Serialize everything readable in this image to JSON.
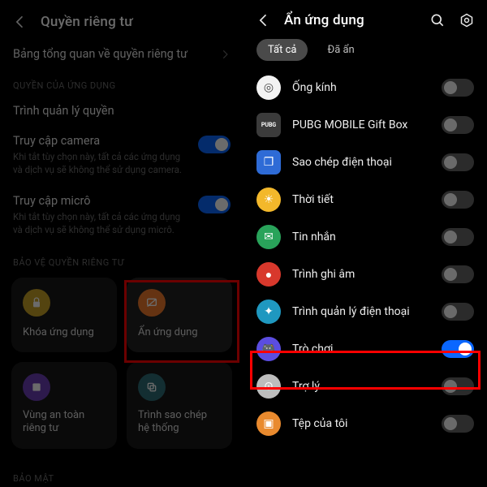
{
  "left": {
    "title": "Quyền riêng tư",
    "overview": "Bảng tổng quan về quyền riêng tư",
    "section_app_perm": "QUYỀN CỦA ỨNG DỤNG",
    "perm_mgr": "Trình quản lý quyền",
    "camera": {
      "title": "Truy cập camera",
      "desc": "Khi tắt tùy chọn này, tất cả các ứng dụng và dịch vụ sẽ không thể sử dụng camera."
    },
    "mic": {
      "title": "Truy cập micrô",
      "desc": "Khi tắt tùy chọn này, tất cả các ứng dụng và dịch vụ sẽ không thể sử dụng micrô."
    },
    "section_protect": "BẢO VỆ QUYỀN RIÊNG TƯ",
    "tiles": {
      "lock": "Khóa ứng dụng",
      "hide": "Ẩn ứng dụng",
      "safe": "Vùng an toàn riêng tư",
      "clone": "Trình sao chép hệ thống"
    },
    "section_security": "BẢO MẬT"
  },
  "right": {
    "title": "Ẩn ứng dụng",
    "tabs": {
      "all": "Tất cả",
      "hidden": "Đã ẩn"
    },
    "apps": [
      {
        "name": "Ống kính",
        "on": false
      },
      {
        "name": "PUBG MOBILE Gift Box",
        "on": false
      },
      {
        "name": "Sao chép điện thoại",
        "on": false
      },
      {
        "name": "Thời tiết",
        "on": false
      },
      {
        "name": "Tin nhắn",
        "on": false
      },
      {
        "name": "Trình ghi âm",
        "on": false
      },
      {
        "name": "Trình quản lý điện thoại",
        "on": false
      },
      {
        "name": "Trò chơi",
        "on": true
      },
      {
        "name": "Trợ lý",
        "on": false
      },
      {
        "name": "Tệp của tôi",
        "on": false
      }
    ]
  }
}
